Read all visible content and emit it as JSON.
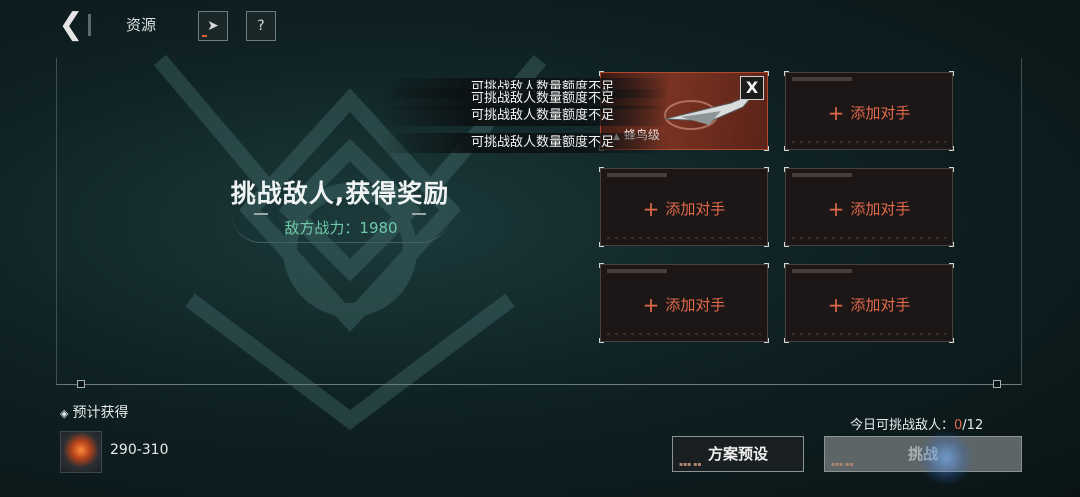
{
  "header": {
    "back_icon": "chevron-left-icon",
    "title": "资源",
    "icons": [
      "rocket-icon",
      "help-icon"
    ]
  },
  "main": {
    "headline": "挑战敌人,获得奖励",
    "power_label": "敌方战力：",
    "power_value": "1980"
  },
  "toasts": [
    "可挑战敌人数量额度不足",
    "可挑战敌人数量额度不足",
    "可挑战敌人数量额度不足",
    "可挑战敌人数量额度不足"
  ],
  "opponents": {
    "occupied": {
      "class_label": "蜂鸟级",
      "close_label": "X"
    },
    "empty_label": "添加对手",
    "plus_glyph": "+"
  },
  "rewards": {
    "title": "预计获得",
    "range": "290-310"
  },
  "daily": {
    "label": "今日可挑战敌人：",
    "used": "0",
    "total": "/12"
  },
  "buttons": {
    "preset": "方案预设",
    "challenge": "挑战"
  },
  "colors": {
    "accent": "#e0694a",
    "power_text": "#6fc9a8",
    "background": "#0f2224"
  }
}
